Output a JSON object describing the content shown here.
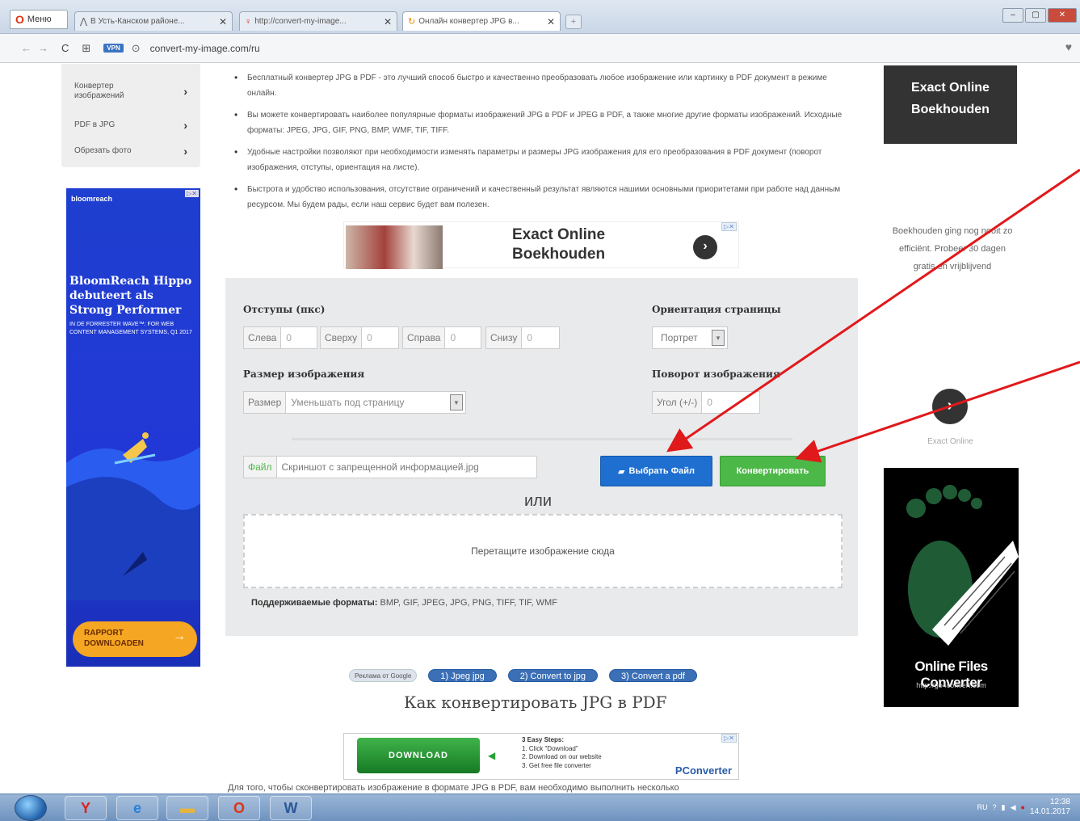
{
  "browser": {
    "menu_label": "Меню",
    "tabs": [
      {
        "label": "В Усть-Канском районе...",
        "icon": "vk-icon"
      },
      {
        "label": "http://convert-my-image...",
        "icon": "pin-icon"
      },
      {
        "label": "Онлайн конвертер JPG в...",
        "icon": "loading-icon"
      }
    ],
    "vpn_label": "VPN",
    "url": "convert-my-image.com/ru"
  },
  "left_menu": {
    "items": [
      {
        "label": "Конвертер изображений"
      },
      {
        "label": "PDF в JPG"
      },
      {
        "label": "Обрезать фото"
      }
    ]
  },
  "ad_left": {
    "brand": "bloomreach",
    "headline": "BloomReach Hippo debuteert als Strong Performer",
    "subtext": "IN DE FORRESTER WAVE™: FOR WEB CONTENT MANAGEMENT SYSTEMS, Q1 2017",
    "cta": "RAPPORT DOWNLOADEN"
  },
  "bullets": [
    "Бесплатный конвертер JPG в PDF - это лучший способ быстро и качественно преобразовать любое изображение или картинку в PDF документ в режиме онлайн.",
    "Вы можете конвертировать наиболее популярные форматы изображений JPG в PDF и JPEG в PDF, а также многие другие форматы изображений. Исходные форматы: JPEG, JPG, GIF, PNG, BMP, WMF, TIF, TIFF.",
    "Удобные настройки позволяют при необходимости изменять параметры и размеры JPG изображения для его преобразования в PDF документ (поворот изображения, отступы, ориентация на листе).",
    "Быстрота и удобство использования, отсутствие ограничений и качественный результат являются нашими основными приоритетами при работе над данным ресурсом. Мы будем рады, если наш сервис будет вам полезен."
  ],
  "ad_mid": {
    "title": "Exact Online Boekhouden"
  },
  "form": {
    "margins_label": "Отступы (пкс)",
    "margins": [
      {
        "label": "Слева",
        "value": "0"
      },
      {
        "label": "Сверху",
        "value": "0"
      },
      {
        "label": "Справа",
        "value": "0"
      },
      {
        "label": "Снизу",
        "value": "0"
      }
    ],
    "orientation_label": "Ориентация страницы",
    "orientation_value": "Портрет",
    "size_label": "Размер изображения",
    "size_field_label": "Размер",
    "size_value": "Уменьшать под страницу",
    "rotation_label": "Поворот изображения",
    "rotation_field_label": "Угол (+/-)",
    "rotation_value": "0",
    "file_label": "Файл",
    "file_value": "Скриншот с запрещенной информацией.jpg",
    "choose_button": "Выбрать Файл",
    "convert_button": "Конвертировать",
    "or_text": "или",
    "dropzone_text": "Перетащите изображение сюда",
    "formats_label": "Поддерживаемые форматы:",
    "formats_value": "BMP, GIF, JPEG, JPG, PNG, TIFF, TIF, WMF"
  },
  "pills": {
    "google_ads": "Реклама от Google",
    "items": [
      "1) Jpeg jpg",
      "2) Convert to jpg",
      "3) Convert a pdf"
    ]
  },
  "how_title": "Как конвертировать JPG в PDF",
  "ad_download": {
    "button": "DOWNLOAD",
    "steps_title": "3 Easy Steps:",
    "steps": [
      "1. Click \"Download\"",
      "2. Download on our website",
      "3. Get free file converter"
    ],
    "brand": "PConverter"
  },
  "bottom_text": "Для того, чтобы сконвертировать изображение в формате JPG в PDF, вам необходимо выполнить несколько",
  "ad_right_top": {
    "title": "Exact Online Boekhouden"
  },
  "ad_right_mid": {
    "text": "Boekhouden ging nog nooit zo efficiënt. Probeer 30 dagen gratis en vrijblijvend",
    "footer": "Exact Online"
  },
  "ad_right_bot": {
    "name": "Online Files Converter",
    "domain": "http://go4convert.com"
  },
  "taskbar": {
    "lang": "RU",
    "time": "12:38",
    "date": "14.01.2017"
  },
  "colors": {
    "blue_button": "#1e6fd0",
    "green_button": "#4cb848",
    "annotation_arrow": "#e0191b"
  }
}
